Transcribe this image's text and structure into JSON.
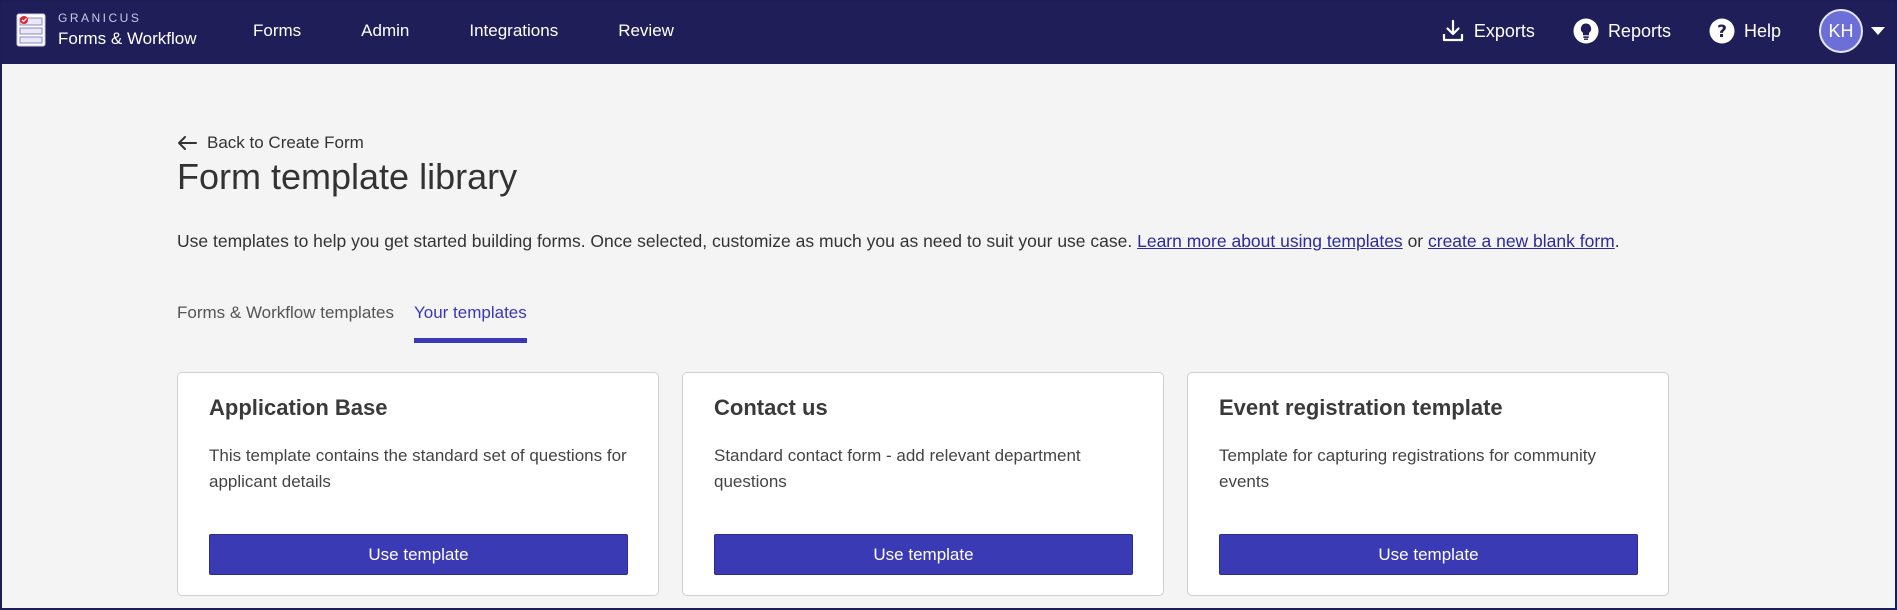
{
  "brand": {
    "company": "GRANICUS",
    "product": "Forms & Workflow"
  },
  "nav": {
    "items": [
      {
        "label": "Forms"
      },
      {
        "label": "Admin"
      },
      {
        "label": "Integrations"
      },
      {
        "label": "Review"
      }
    ],
    "exports_label": "Exports",
    "reports_label": "Reports",
    "help_label": "Help",
    "user_initials": "KH"
  },
  "page": {
    "back_label": "Back to Create Form",
    "title": "Form template library",
    "intro_text": "Use templates to help you get started building forms. Once selected, customize as much you as need to suit your use case.",
    "intro_link_learn": "Learn more about using templates",
    "intro_or": "or",
    "intro_link_blank": "create a new blank form",
    "intro_period": "."
  },
  "tabs": [
    {
      "label": "Forms & Workflow templates",
      "active": false
    },
    {
      "label": "Your templates",
      "active": true
    }
  ],
  "cards": [
    {
      "title": "Application Base",
      "description": "This template contains the standard set of questions for applicant details",
      "button_label": "Use template"
    },
    {
      "title": "Contact us",
      "description": "Standard contact form - add relevant department questions",
      "button_label": "Use template"
    },
    {
      "title": "Event registration template",
      "description": "Template for capturing registrations for community events",
      "button_label": "Use template"
    }
  ],
  "colors": {
    "nav_bg": "#201e58",
    "accent": "#3b38b4",
    "button": "#3b3ab5",
    "avatar": "#6d6fd9"
  },
  "icons": {
    "brand": "forms-logo-icon",
    "exports": "download-icon",
    "reports": "lightbulb-icon",
    "help": "question-circle-icon",
    "back": "arrow-left-icon",
    "user_menu": "caret-down-icon"
  }
}
